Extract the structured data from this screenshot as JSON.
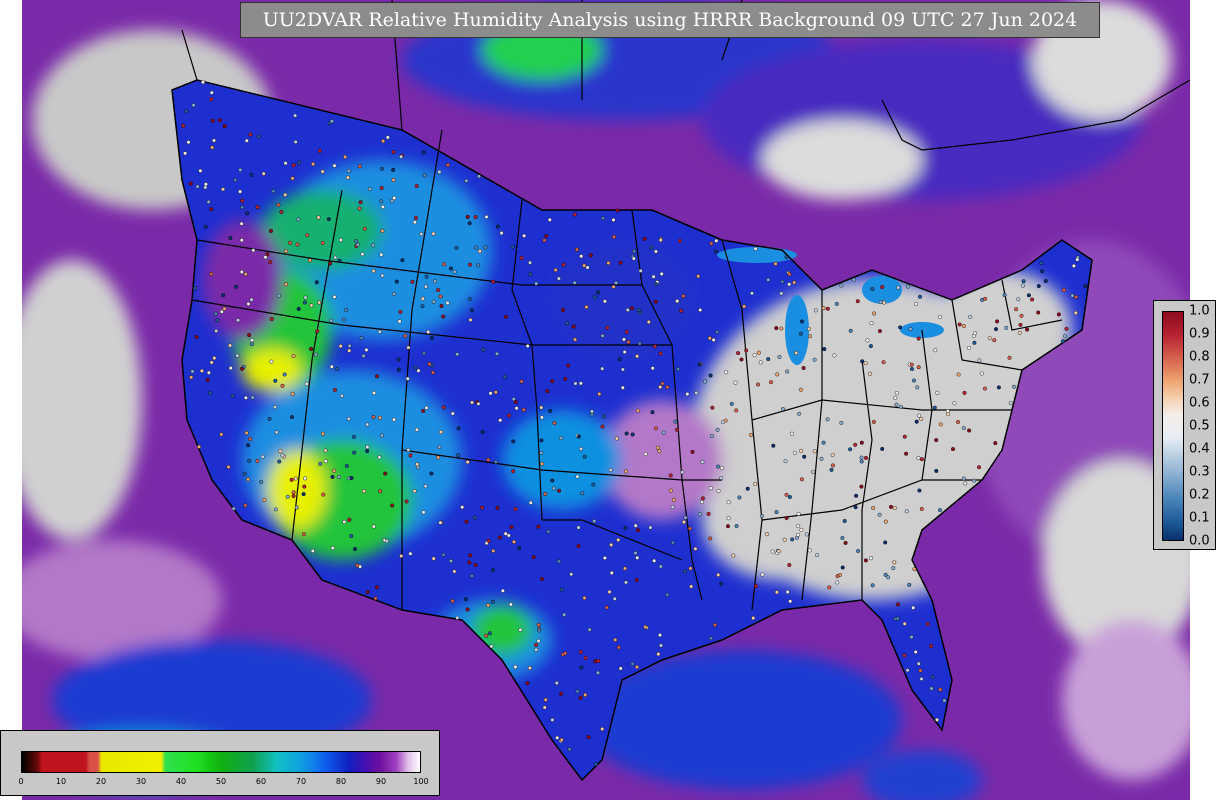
{
  "title": "UU2DVAR Relative Humidity Analysis using HRRR Background 09 UTC 27 Jun 2024",
  "rh_legend": {
    "ticks": [
      "0",
      "10",
      "20",
      "30",
      "40",
      "50",
      "60",
      "70",
      "80",
      "90",
      "100"
    ],
    "stops": [
      {
        "pos": 0.0,
        "color": "#000000"
      },
      {
        "pos": 0.04,
        "color": "#6a0a0a"
      },
      {
        "pos": 0.05,
        "color": "#c0141e"
      },
      {
        "pos": 0.16,
        "color": "#c0141e"
      },
      {
        "pos": 0.17,
        "color": "#d85048"
      },
      {
        "pos": 0.19,
        "color": "#d85048"
      },
      {
        "pos": 0.2,
        "color": "#e8e800"
      },
      {
        "pos": 0.35,
        "color": "#f0f000"
      },
      {
        "pos": 0.36,
        "color": "#30e050"
      },
      {
        "pos": 0.44,
        "color": "#20e020"
      },
      {
        "pos": 0.5,
        "color": "#10b010"
      },
      {
        "pos": 0.58,
        "color": "#10a050"
      },
      {
        "pos": 0.64,
        "color": "#10c0c0"
      },
      {
        "pos": 0.7,
        "color": "#10a0e0"
      },
      {
        "pos": 0.76,
        "color": "#1060f0"
      },
      {
        "pos": 0.82,
        "color": "#1020c0"
      },
      {
        "pos": 0.86,
        "color": "#4010b0"
      },
      {
        "pos": 0.9,
        "color": "#7010a0"
      },
      {
        "pos": 0.94,
        "color": "#a040c0"
      },
      {
        "pos": 0.97,
        "color": "#e0c0e8"
      },
      {
        "pos": 1.0,
        "color": "#ffffff"
      }
    ]
  },
  "ratio_legend": {
    "ticks": [
      "1.0",
      "0.9",
      "0.8",
      "0.7",
      "0.6",
      "0.5",
      "0.4",
      "0.3",
      "0.2",
      "0.1",
      "0.0"
    ],
    "stops": [
      {
        "pos": 0.0,
        "color": "#8c0c1e"
      },
      {
        "pos": 0.1,
        "color": "#b62232"
      },
      {
        "pos": 0.2,
        "color": "#d4604c"
      },
      {
        "pos": 0.3,
        "color": "#eea470"
      },
      {
        "pos": 0.38,
        "color": "#f4d0b0"
      },
      {
        "pos": 0.45,
        "color": "#f4eeea"
      },
      {
        "pos": 0.55,
        "color": "#e8eef4"
      },
      {
        "pos": 0.62,
        "color": "#c0d2e4"
      },
      {
        "pos": 0.72,
        "color": "#86acd0"
      },
      {
        "pos": 0.82,
        "color": "#4a84b8"
      },
      {
        "pos": 0.92,
        "color": "#1e5a9a"
      },
      {
        "pos": 1.0,
        "color": "#0a306c"
      }
    ]
  },
  "colors": {
    "ocean": "#7a2aa8",
    "land_humid": "#1e2fd0",
    "land_moist": "#1a8ee0",
    "land_dry": "#22c43a",
    "land_very_dry": "#e6f000",
    "land_saturated": "#cfcfcf",
    "boundary": "#000000"
  }
}
